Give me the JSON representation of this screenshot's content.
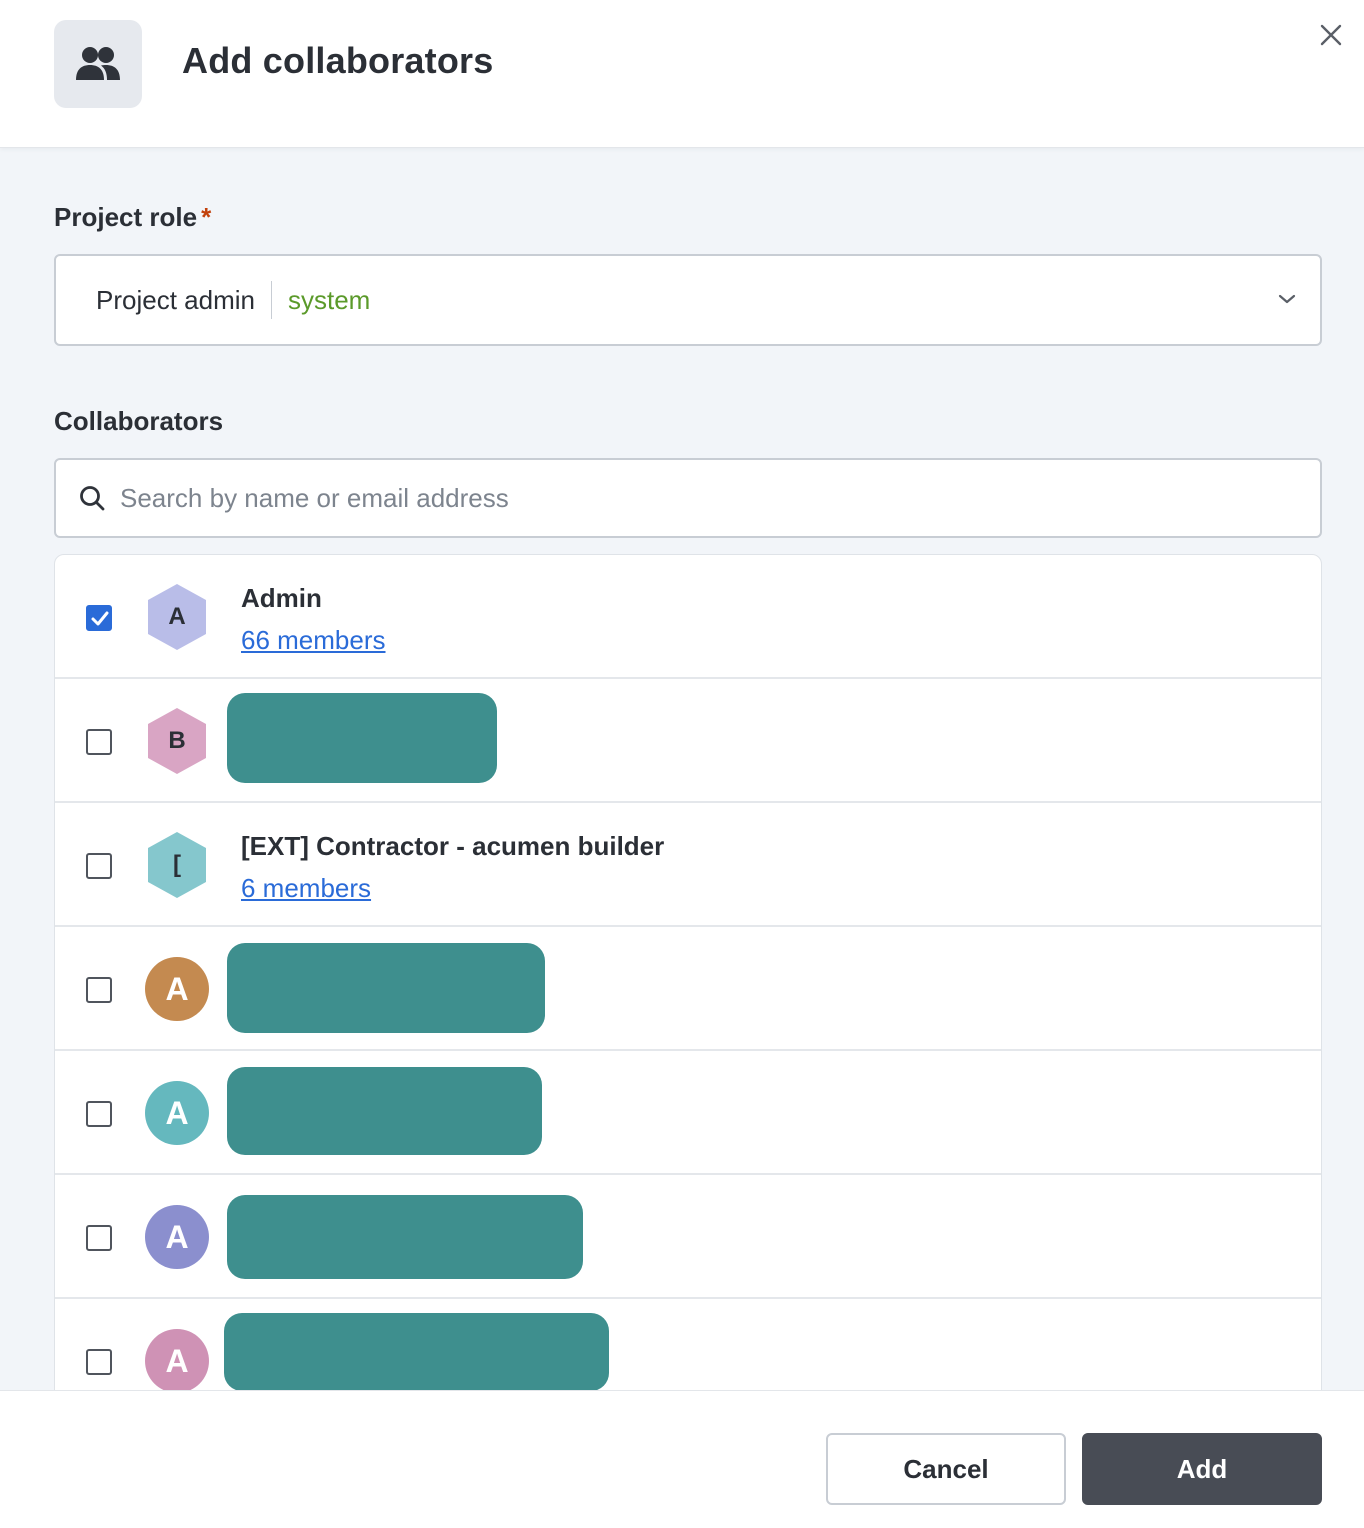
{
  "dialog": {
    "title": "Add collaborators",
    "header_icon": "users-icon",
    "close_icon": "close-icon"
  },
  "role": {
    "label": "Project role",
    "required_mark": "*",
    "selected_value": "Project admin",
    "selected_tag": "system"
  },
  "collaborators": {
    "label": "Collaborators",
    "search_placeholder": "Search by name or email address",
    "search_value": "",
    "items": [
      {
        "initial": "A",
        "name": "Admin",
        "link": "66 members",
        "checked": true,
        "avatar_shape": "hexagon",
        "avatar_color": "#b9bde8"
      },
      {
        "initial": "B",
        "name": "",
        "link": "",
        "checked": false,
        "avatar_shape": "hexagon",
        "avatar_color": "#d9a5c4",
        "redacted": true
      },
      {
        "initial": "[",
        "name": "[EXT] Contractor - acumen builder",
        "link": "6 members",
        "checked": false,
        "avatar_shape": "hexagon",
        "avatar_color": "#85c7cd"
      },
      {
        "initial": "A",
        "name": "",
        "link": "",
        "checked": false,
        "avatar_shape": "circle",
        "avatar_color": "#c48a50",
        "redacted": true
      },
      {
        "initial": "A",
        "name": "",
        "link": "",
        "checked": false,
        "avatar_shape": "circle",
        "avatar_color": "#65b8be",
        "redacted": true
      },
      {
        "initial": "A",
        "name": "",
        "link": "",
        "checked": false,
        "avatar_shape": "circle",
        "avatar_color": "#8b8fce",
        "redacted": true
      },
      {
        "initial": "A",
        "name": "",
        "link": "",
        "checked": false,
        "avatar_shape": "circle",
        "avatar_color": "#cf92b5",
        "redacted": true
      }
    ]
  },
  "footer": {
    "cancel_label": "Cancel",
    "add_label": "Add"
  },
  "colors": {
    "accent": "#2a6bd8",
    "tag_green": "#5b9a2a",
    "required_red": "#c2410c",
    "primary_button": "#484c55",
    "redaction": "#3e8f8e"
  }
}
